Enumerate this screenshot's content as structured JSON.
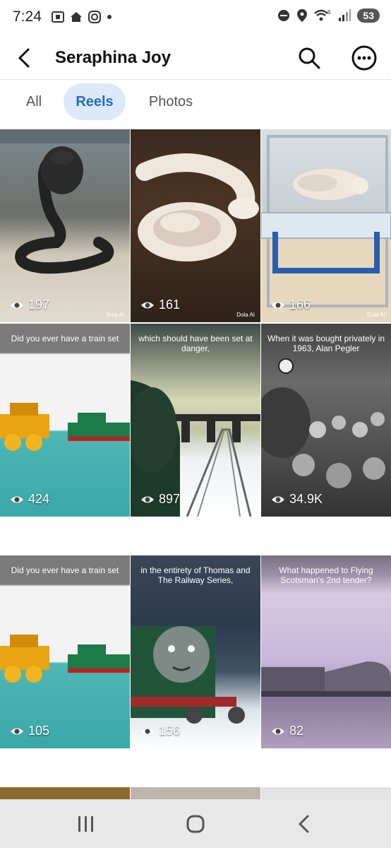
{
  "status_bar": {
    "time": "7:24",
    "battery": "53"
  },
  "header": {
    "title": "Seraphina Joy"
  },
  "tabs": [
    {
      "label": "All",
      "selected": false
    },
    {
      "label": "Reels",
      "selected": true
    },
    {
      "label": "Photos",
      "selected": false
    }
  ],
  "reels": [
    {
      "views": "197",
      "caption": "",
      "watermark": "Dola AI"
    },
    {
      "views": "161",
      "caption": "",
      "watermark": "Dola AI"
    },
    {
      "views": "166",
      "caption": "",
      "watermark": "Dola AI"
    },
    {
      "views": "424",
      "caption": "Did you ever have a train set",
      "watermark": ""
    },
    {
      "views": "897",
      "caption": "which should have been set at danger,",
      "watermark": ""
    },
    {
      "views": "34.9K",
      "caption": "When it was bought privately in 1963, Alan Pegler",
      "watermark": ""
    },
    {
      "views": "105",
      "caption": "Did you ever have a train set",
      "watermark": ""
    },
    {
      "views": "156",
      "caption": "in the entirety of Thomas and The Railway Series,",
      "watermark": ""
    },
    {
      "views": "82",
      "caption": "What happened to Flying Scotsman's 2nd tender?",
      "watermark": ""
    }
  ]
}
